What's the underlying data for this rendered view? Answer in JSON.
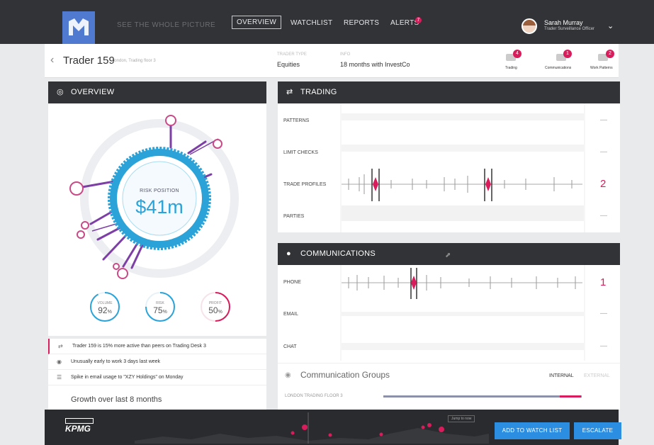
{
  "topbar": {
    "tagline": "SEE THE WHOLE PICTURE",
    "nav": [
      "OVERVIEW",
      "WATCHLIST",
      "REPORTS",
      "ALERTS"
    ],
    "active_nav": "OVERVIEW",
    "alerts_count": "7",
    "user_name": "Sarah Murray",
    "user_role": "Trader Surveillance Officer"
  },
  "trader": {
    "title": "Trader 159",
    "location": "London, Trading floor 3",
    "type_label": "TRADER TYPE",
    "type_value": "Equities",
    "info_label": "INFO",
    "info_value": "18 months with InvestCo",
    "badges": [
      {
        "label": "Trading",
        "count": "4"
      },
      {
        "label": "Communications",
        "count": "1"
      },
      {
        "label": "Work Patterns",
        "count": "2"
      }
    ]
  },
  "overview": {
    "header": "OVERVIEW",
    "risk_label": "RISK POSITION",
    "risk_value": "$41m",
    "metrics": [
      {
        "label": "VOLUME",
        "value": "92",
        "unit": "%",
        "level": 0.92
      },
      {
        "label": "RISK",
        "value": "75",
        "unit": "%",
        "level": 0.75
      },
      {
        "label": "PROFIT",
        "value": "50",
        "unit": "%",
        "level": 0.5
      }
    ],
    "insights": [
      "Trader 159 is 15% more active than peers on Trading Desk 3",
      "Unusually early to work 3 days last week",
      "Spike in email usage to \"XZY Holdings\" on Monday"
    ],
    "growth": "Growth over last 8 months"
  },
  "trading": {
    "header": "TRADING",
    "rows": [
      {
        "label": "PATTERNS",
        "flag": "—"
      },
      {
        "label": "LIMIT CHECKS",
        "flag": "—"
      },
      {
        "label": "TRADE PROFILES",
        "flag": "2"
      },
      {
        "label": "PARTIES",
        "flag": "—"
      }
    ]
  },
  "communications": {
    "header": "COMMUNICATIONS",
    "rows": [
      {
        "label": "PHONE",
        "flag": "1"
      },
      {
        "label": "EMAIL",
        "flag": "—"
      },
      {
        "label": "CHAT",
        "flag": "—"
      }
    ],
    "groups_title": "Communication Groups",
    "tab_internal": "INTERNAL",
    "tab_external": "EXTERNAL",
    "group_row": "LONDON TRADING FLOOR 3"
  },
  "footer": {
    "brand": "KPMG",
    "jump": "Jump to now",
    "add_watch": "ADD TO WATCH LIST",
    "escalate": "ESCALATE"
  },
  "colors": {
    "accent": "#d81c5c",
    "blue": "#2ba3d9",
    "dark": "#323336",
    "button": "#2c8ee0"
  }
}
